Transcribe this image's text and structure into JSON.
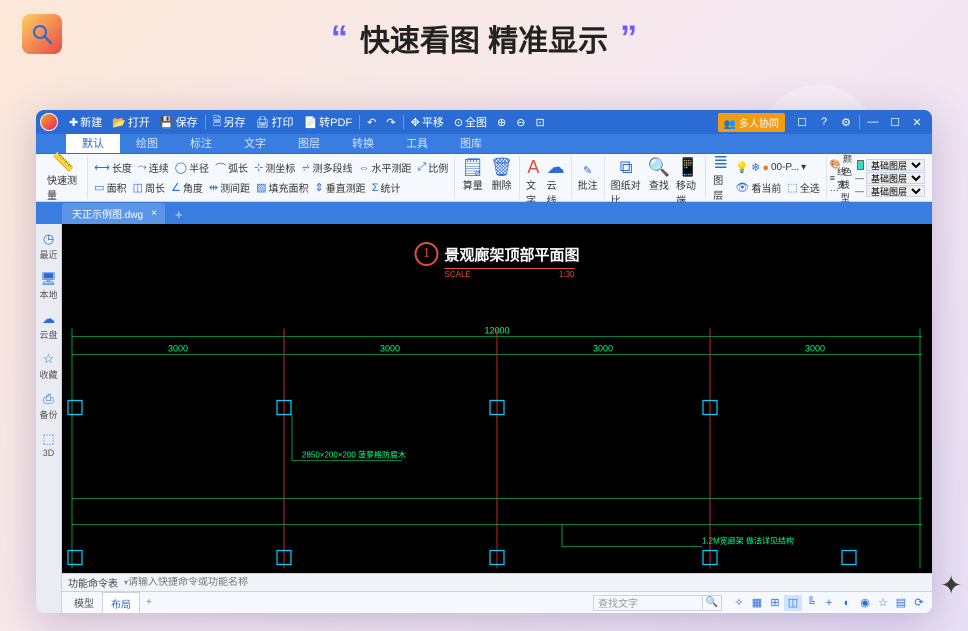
{
  "hero": {
    "title": "快速看图 精准显示"
  },
  "titlebar": {
    "new": "新建",
    "open": "打开",
    "save": "保存",
    "saveas": "另存",
    "print": "打印",
    "topdf": "转PDF",
    "pan": "平移",
    "full": "全图",
    "collab": "多人协同"
  },
  "ribbonTabs": [
    "默认",
    "绘图",
    "标注",
    "文字",
    "图层",
    "转换",
    "工具",
    "图库"
  ],
  "ribbon": {
    "quickMeasure": "快速测量",
    "r1": {
      "length": "长度",
      "cont": "连续",
      "radius": "半径",
      "arclen": "弧长",
      "coord": "测坐标",
      "polyline": "测多段线",
      "hmeasure": "水平测距",
      "scale": "比例"
    },
    "r2": {
      "area": "面积",
      "perim": "周长",
      "angle": "角度",
      "mdist": "测间距",
      "fillarea": "填充面积",
      "vmeasure": "垂直测距",
      "stats": "统计"
    },
    "calc": "算量",
    "delete": "删除",
    "text": "文字",
    "cloud": "云线",
    "compare": "图纸对比",
    "find": "查找",
    "mobile": "移动端",
    "layer": "图层",
    "lookcur": "看当前",
    "selall": "全选",
    "layerbox": "00-P...",
    "color": "颜色",
    "lw": "线宽",
    "lt": "线型",
    "layeropt": "基础图层",
    "annotate": "批注"
  },
  "fileTab": "天正示例图.dwg",
  "leftRail": [
    "最近",
    "本地",
    "云盘",
    "收藏",
    "备份",
    "3D"
  ],
  "drawing": {
    "title": "景观廊架顶部平面图",
    "scaleLabel": "SCALE",
    "scaleValue": "1:30",
    "totalDim": "12000",
    "dims": [
      "3000",
      "3000",
      "3000",
      "3000"
    ],
    "anno1": "2850×200×200 菠萝格防腐木",
    "anno2": "1.2M宽廊架 做法详见结构"
  },
  "cmdBar": {
    "label": "功能命令表",
    "placeholder": "请输入快捷命令或功能名称"
  },
  "statusBar": {
    "model": "模型",
    "layout": "布局",
    "searchPlaceholder": "查找文字"
  }
}
